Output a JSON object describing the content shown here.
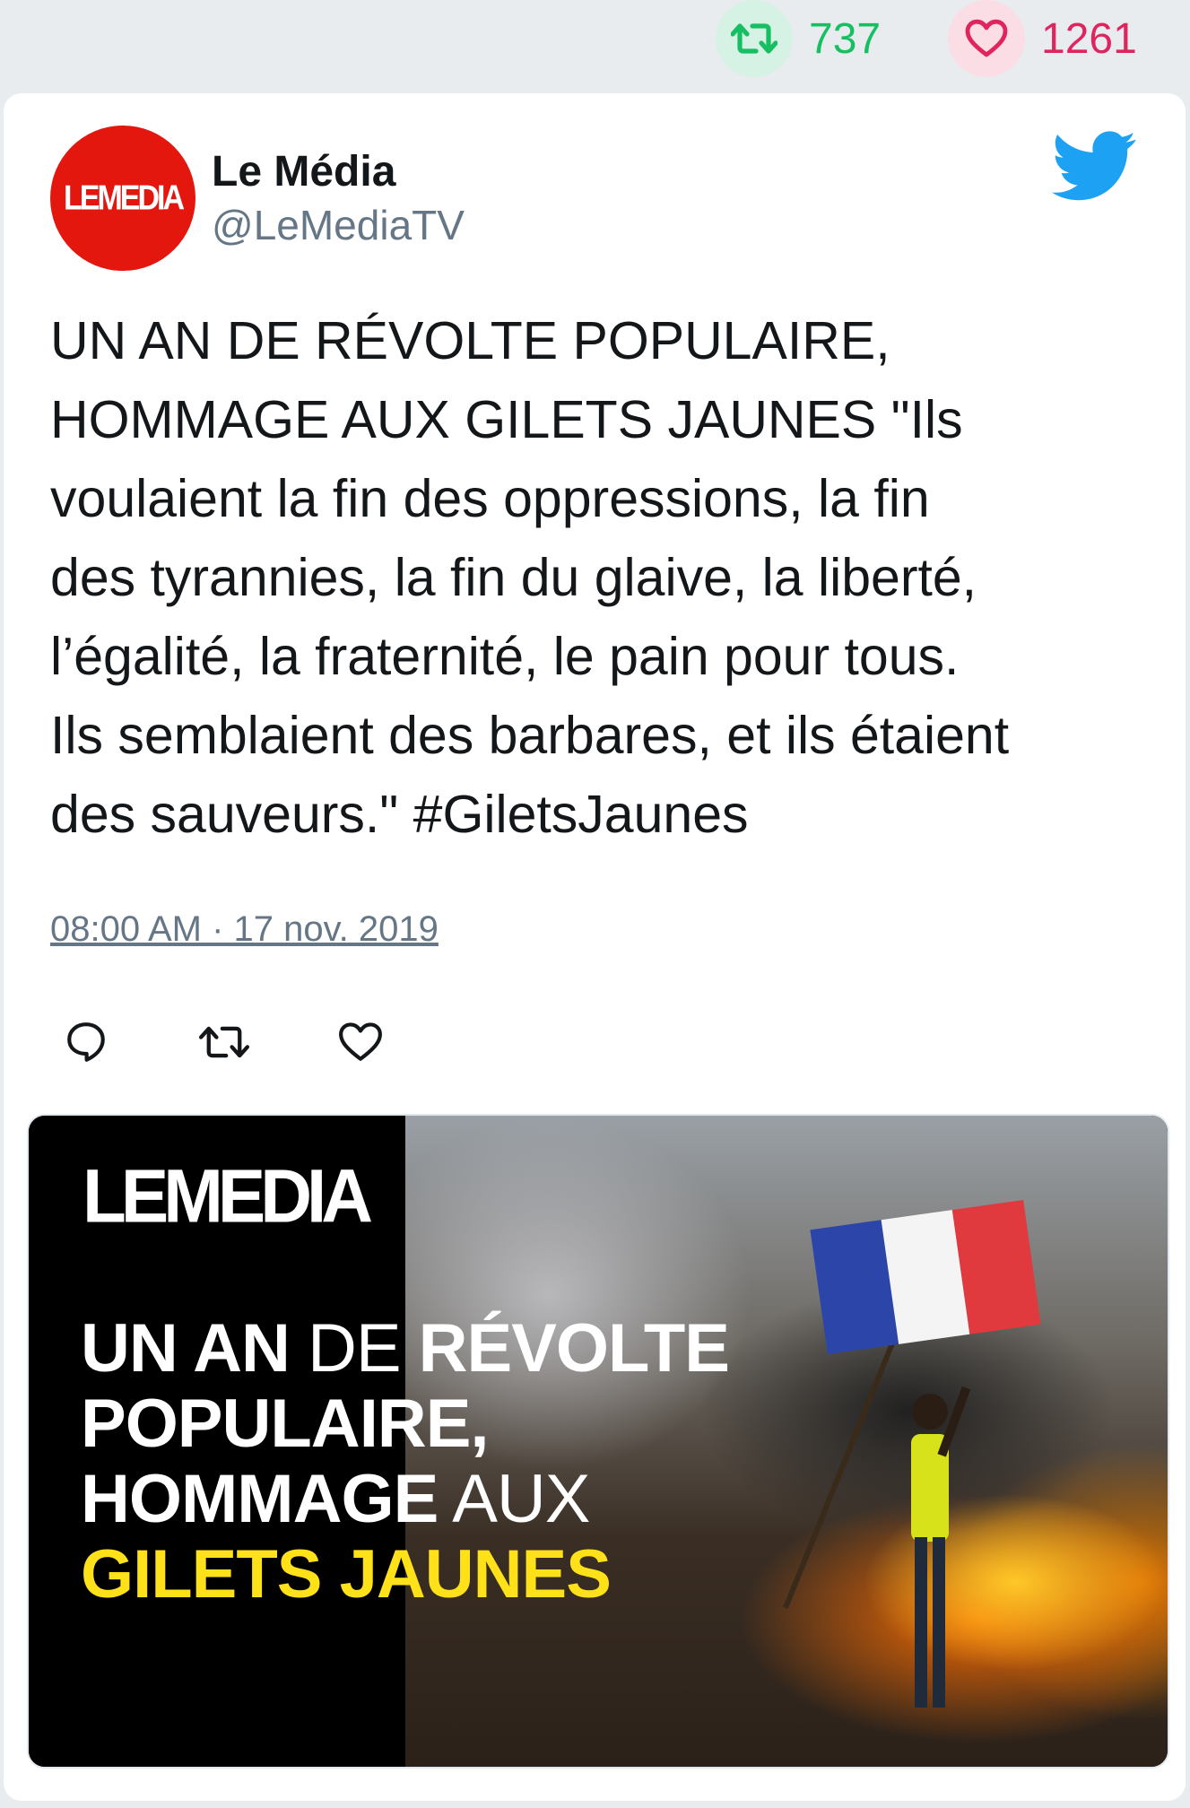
{
  "stats": {
    "retweet_count": "737",
    "like_count": "1261",
    "retweet_color": "#17bf63",
    "like_color": "#e0245e",
    "retweet_icon": "retweet-icon",
    "like_icon": "heart-icon"
  },
  "tweet": {
    "avatar_text": "LEMEDIA",
    "display_name": "Le Média",
    "handle": "@LeMediaTV",
    "text": "UN AN DE RÉVOLTE POPULAIRE,\nHOMMAGE AUX GILETS JAUNES \"Ils\nvoulaient la fin des oppressions, la fin\ndes tyrannies, la fin du glaive, la liberté,\nl’égalité, la fraternité, le pain pour tous.\nIls semblaient des barbares, et ils étaient\ndes sauveurs.\" #GiletsJaunes",
    "timestamp": "08:00 AM · 17 nov. 2019",
    "brand_icon": "twitter-bird-icon",
    "brand_color": "#1da1f2",
    "avatar_color": "#e3170e"
  },
  "actions": [
    {
      "name": "reply",
      "icon": "reply-icon"
    },
    {
      "name": "retweet",
      "icon": "retweet-icon"
    },
    {
      "name": "like",
      "icon": "heart-icon"
    }
  ],
  "media": {
    "logo_text": "LEMEDIA",
    "headline": {
      "line1_bold_a": "UN AN",
      "line1_thin": " DE ",
      "line1_bold_b": "RÉVOLTE",
      "line2": "POPULAIRE,",
      "line3_bold": "HOMMAGE",
      "line3_thin": " AUX",
      "line4": "GILETS JAUNES"
    },
    "accent_yellow": "#ffe11a"
  }
}
